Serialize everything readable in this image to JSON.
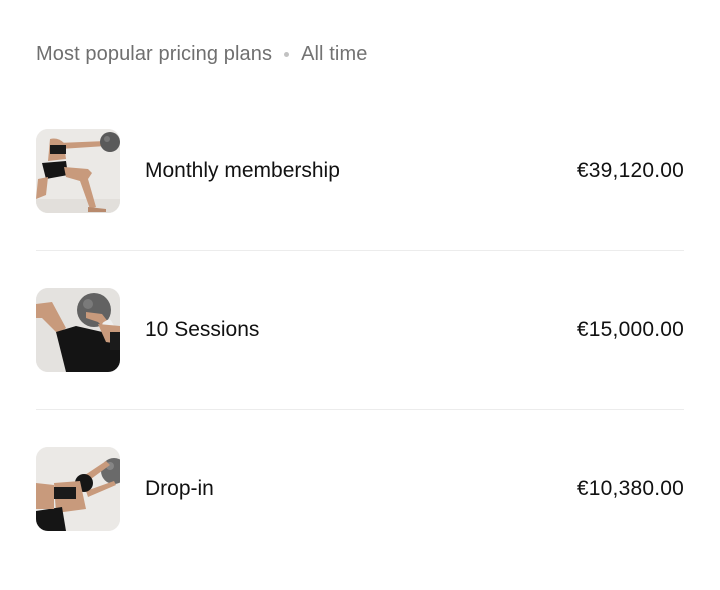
{
  "header": {
    "title": "Most popular pricing plans",
    "period": "All time"
  },
  "plans": [
    {
      "name": "Monthly membership",
      "price": "€39,120.00",
      "image": "yoga-ball-lunge-photo"
    },
    {
      "name": "10 Sessions",
      "price": "€15,000.00",
      "image": "yoga-ball-floor-photo"
    },
    {
      "name": "Drop-in",
      "price": "€10,380.00",
      "image": "yoga-ball-stretch-photo"
    }
  ],
  "colors": {
    "text": "#111111",
    "muted": "#6f6f6f",
    "divider": "#ececec",
    "photo_background": "#ebe9e6"
  }
}
